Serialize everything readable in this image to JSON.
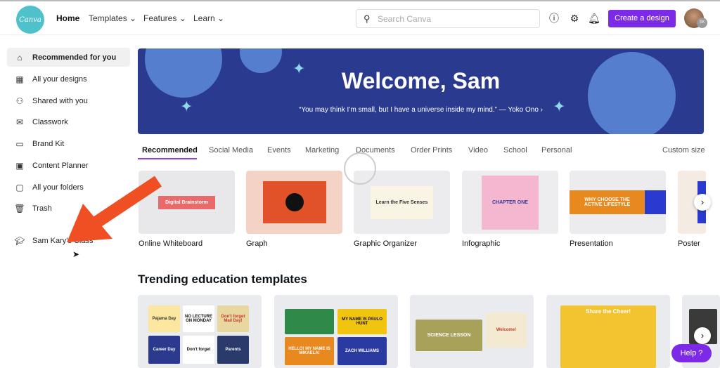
{
  "header": {
    "logo": "Canva",
    "nav": [
      {
        "label": "Home"
      },
      {
        "label": "Templates ⌄"
      },
      {
        "label": "Features ⌄"
      },
      {
        "label": "Learn ⌄"
      }
    ],
    "search_placeholder": "Search Canva",
    "create_label": "Create a design",
    "avatar_initials": "SK"
  },
  "sidebar": {
    "items": [
      {
        "label": "Recommended for you",
        "icon": "home-icon"
      },
      {
        "label": "All your designs",
        "icon": "grid-icon"
      },
      {
        "label": "Shared with you",
        "icon": "people-icon"
      },
      {
        "label": "Classwork",
        "icon": "inbox-icon"
      },
      {
        "label": "Brand Kit",
        "icon": "brand-icon"
      },
      {
        "label": "Content Planner",
        "icon": "calendar-icon"
      },
      {
        "label": "All your folders",
        "icon": "folder-icon"
      },
      {
        "label": "Trash",
        "icon": "trash-icon"
      }
    ],
    "class_item": "Sam Kary's Class"
  },
  "banner": {
    "title": "Welcome, Sam",
    "quote": "“You may think I’m small, but I have a universe inside my mind.” — Yoko Ono ›"
  },
  "tabs": [
    "Recommended",
    "Social Media",
    "Events",
    "Marketing",
    "Documents",
    "Order Prints",
    "Video",
    "School",
    "Personal"
  ],
  "custom_size": "Custom size",
  "design_types": [
    {
      "label": "Online Whiteboard",
      "thumb_text": "Digital Brainstorm"
    },
    {
      "label": "Graph",
      "thumb_text": ""
    },
    {
      "label": "Graphic Organizer",
      "thumb_text": "Learn the Five Senses"
    },
    {
      "label": "Infographic",
      "thumb_text": "CHAPTER ONE"
    },
    {
      "label": "Presentation",
      "thumb_text": "WHY CHOOSE THE ACTIVE LIFESTYLE"
    },
    {
      "label": "Poster",
      "thumb_text": ""
    }
  ],
  "trending": {
    "title": "Trending education templates",
    "cards": [
      [
        "Pajama Day",
        "NO LECTURE ON MONDAY",
        "Don't forget Mail Day!",
        "Career Day",
        "Don't forget",
        "Parents"
      ],
      [
        "MY NAME IS PAULO HUNT",
        "HELLO! MY NAME IS MIKAELA!",
        "ZACH WILLIAMS"
      ],
      [
        "SCIENCE LESSON",
        "Welcome!"
      ],
      [
        "Share the Cheer!"
      ]
    ]
  },
  "help_label": "Help ?",
  "colors": {
    "accent": "#7d2ae8",
    "banner": "#2a3a8f",
    "logo": "#4fc1cb",
    "arrow": "#f04e23"
  }
}
